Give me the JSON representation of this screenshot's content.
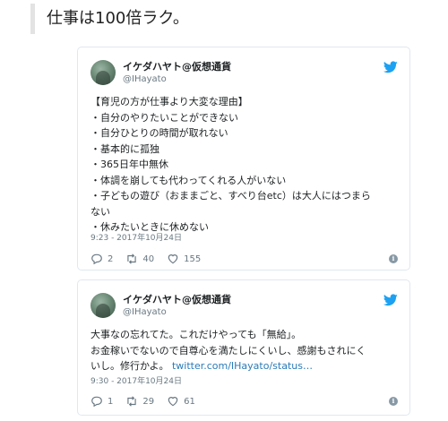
{
  "quote": {
    "text": "仕事は100倍ラク。"
  },
  "colors": {
    "twitter_blue": "#1da1f2",
    "link": "#2b7bb9",
    "muted": "#697882",
    "border": "#e1e8ed"
  },
  "tweets": [
    {
      "display_name": "イケダハヤト@仮想通貨",
      "screen_name": "@IHayato",
      "body_lines": [
        "【育児の方が仕事より大変な理由】",
        "・自分のやりたいことができない",
        "・自分ひとりの時間が取れない",
        "・基本的に孤独",
        "・365日年中無休",
        "・体調を崩しても代わってくれる人がいない",
        "・子どもの遊び（おままごと、すべり台etc）は大人にはつまら",
        "ない",
        "・休みたいときに休めない"
      ],
      "timestamp": "9:23 - 2017年10月24日",
      "replies": "2",
      "retweets": "40",
      "likes": "155"
    },
    {
      "display_name": "イケダハヤト@仮想通貨",
      "screen_name": "@IHayato",
      "body_lines": [
        "大事なの忘れてた。これだけやっても「無給」。",
        "お金稼いでないので自尊心を満たしにくいし、感謝もされにく",
        "いし。修行かよ。"
      ],
      "link_text": "twitter.com/IHayato/status…",
      "timestamp": "9:30 - 2017年10月24日",
      "replies": "1",
      "retweets": "29",
      "likes": "61"
    }
  ],
  "icons": {
    "brand": "twitter-bird-icon",
    "reply": "reply-icon",
    "retweet": "retweet-icon",
    "like": "heart-icon",
    "info": "info-icon"
  }
}
